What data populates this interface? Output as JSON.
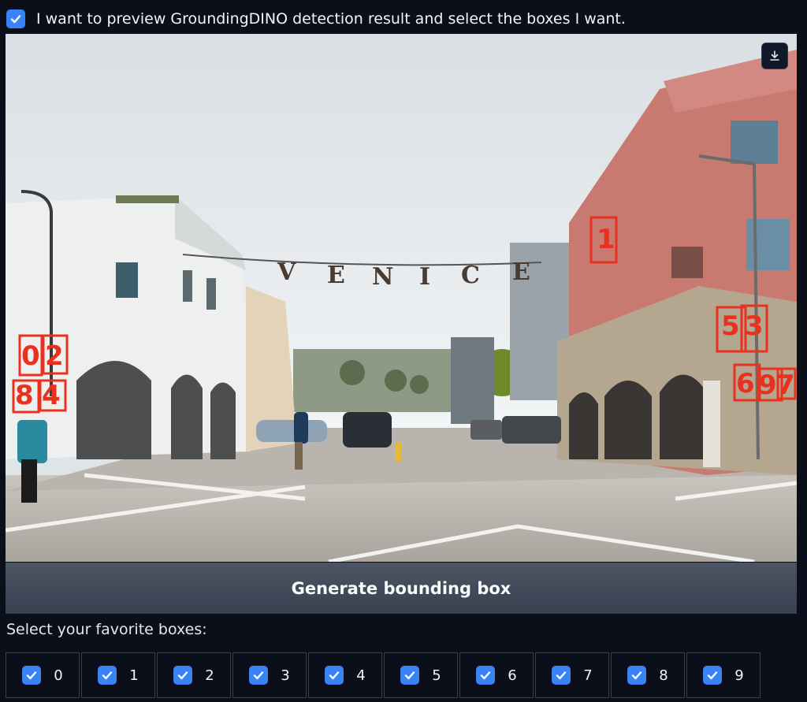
{
  "preview_toggle": {
    "label": "I want to preview GroundingDINO detection result and select the boxes I want.",
    "checked": true
  },
  "image": {
    "sign_letters": [
      "V",
      "E",
      "N",
      "I",
      "C",
      "E"
    ],
    "box_labels": [
      "0",
      "1",
      "2",
      "3",
      "4",
      "5",
      "6",
      "7",
      "8",
      "9"
    ],
    "download_icon": "download-icon",
    "box_color": "#e8321f"
  },
  "generate_button": {
    "label": "Generate bounding box"
  },
  "selection": {
    "label": "Select your favorite boxes:",
    "options": [
      {
        "label": "0",
        "checked": true
      },
      {
        "label": "1",
        "checked": true
      },
      {
        "label": "2",
        "checked": true
      },
      {
        "label": "3",
        "checked": true
      },
      {
        "label": "4",
        "checked": true
      },
      {
        "label": "5",
        "checked": true
      },
      {
        "label": "6",
        "checked": true
      },
      {
        "label": "7",
        "checked": true
      },
      {
        "label": "8",
        "checked": true
      },
      {
        "label": "9",
        "checked": true
      }
    ]
  },
  "colors": {
    "accent": "#3b82f6",
    "background": "#0b0f19"
  }
}
